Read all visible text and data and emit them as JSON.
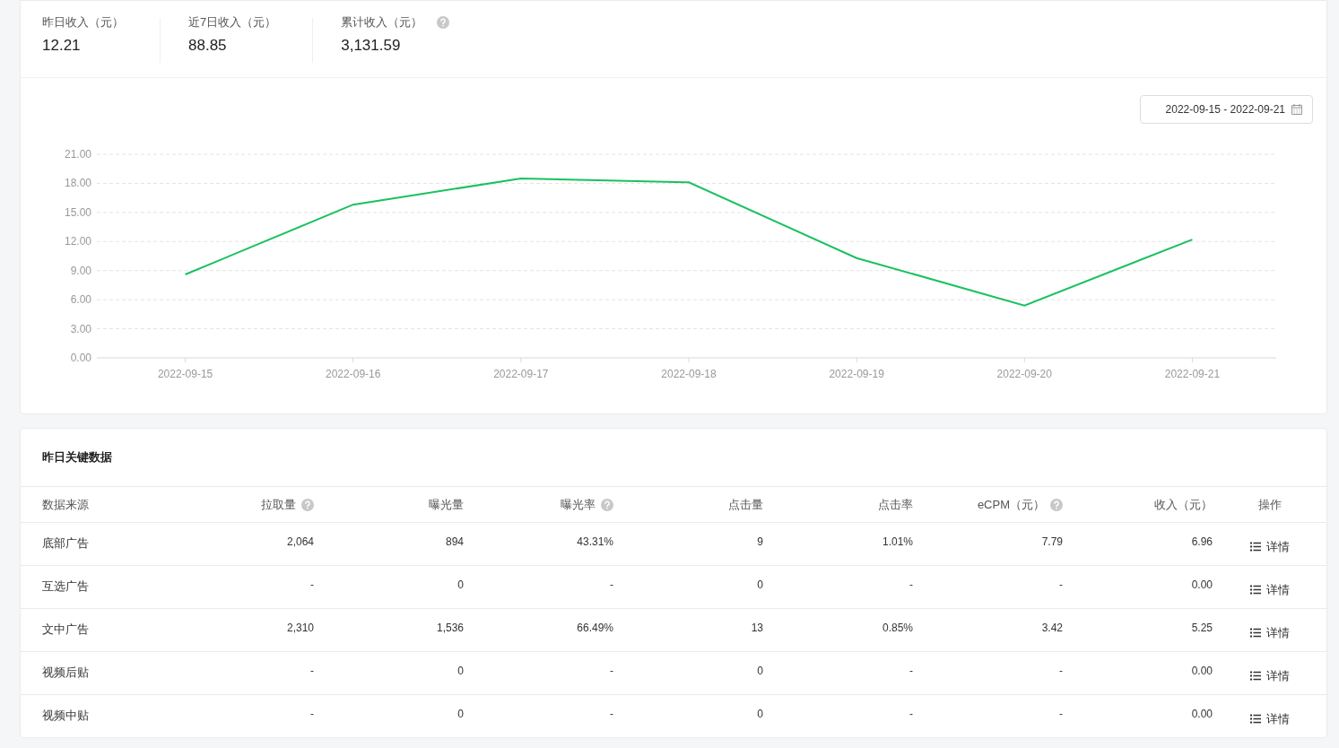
{
  "summary": [
    {
      "label": "昨日收入（元）",
      "value": "12.21",
      "help": false
    },
    {
      "label": "近7日收入（元）",
      "value": "88.85",
      "help": false
    },
    {
      "label": "累计收入（元）",
      "value": "3,131.59",
      "help": true
    }
  ],
  "date_range": "2022-09-15 - 2022-09-21",
  "chart_data": {
    "type": "line",
    "categories": [
      "2022-09-15",
      "2022-09-16",
      "2022-09-17",
      "2022-09-18",
      "2022-09-19",
      "2022-09-20",
      "2022-09-21"
    ],
    "series": [
      {
        "color": "#19c15f",
        "values": [
          8.6,
          15.8,
          18.5,
          18.1,
          10.3,
          5.4,
          12.2
        ]
      }
    ],
    "grid": true,
    "ylim": [
      0,
      21
    ],
    "yticks": [
      {
        "value": 0,
        "label": "0.00"
      },
      {
        "value": 3,
        "label": "3.00"
      },
      {
        "value": 6,
        "label": "6.00"
      },
      {
        "value": 9,
        "label": "9.00"
      },
      {
        "value": 12,
        "label": "12.00"
      },
      {
        "value": 15,
        "label": "15.00"
      },
      {
        "value": 18,
        "label": "18.00"
      },
      {
        "value": 21,
        "label": "21.00"
      }
    ]
  },
  "table": {
    "title": "昨日关键数据",
    "columns": [
      {
        "label": "数据来源",
        "help": false
      },
      {
        "label": "拉取量",
        "help": true
      },
      {
        "label": "曝光量",
        "help": false
      },
      {
        "label": "曝光率",
        "help": true
      },
      {
        "label": "点击量",
        "help": false
      },
      {
        "label": "点击率",
        "help": false
      },
      {
        "label": "eCPM（元）",
        "help": true
      },
      {
        "label": "收入（元）",
        "help": false
      },
      {
        "label": "操作",
        "help": false
      }
    ],
    "rows": [
      {
        "cells": [
          "底部广告",
          "2,064",
          "894",
          "43.31%",
          "9",
          "1.01%",
          "7.79",
          "6.96"
        ],
        "action": "详情"
      },
      {
        "cells": [
          "互选广告",
          "-",
          "0",
          "-",
          "0",
          "-",
          "-",
          "0.00"
        ],
        "action": "详情"
      },
      {
        "cells": [
          "文中广告",
          "2,310",
          "1,536",
          "66.49%",
          "13",
          "0.85%",
          "3.42",
          "5.25"
        ],
        "action": "详情"
      },
      {
        "cells": [
          "视频后贴",
          "-",
          "0",
          "-",
          "0",
          "-",
          "-",
          "0.00"
        ],
        "action": "详情"
      },
      {
        "cells": [
          "视频中贴",
          "-",
          "0",
          "-",
          "0",
          "-",
          "-",
          "0.00"
        ],
        "action": "详情"
      }
    ]
  }
}
